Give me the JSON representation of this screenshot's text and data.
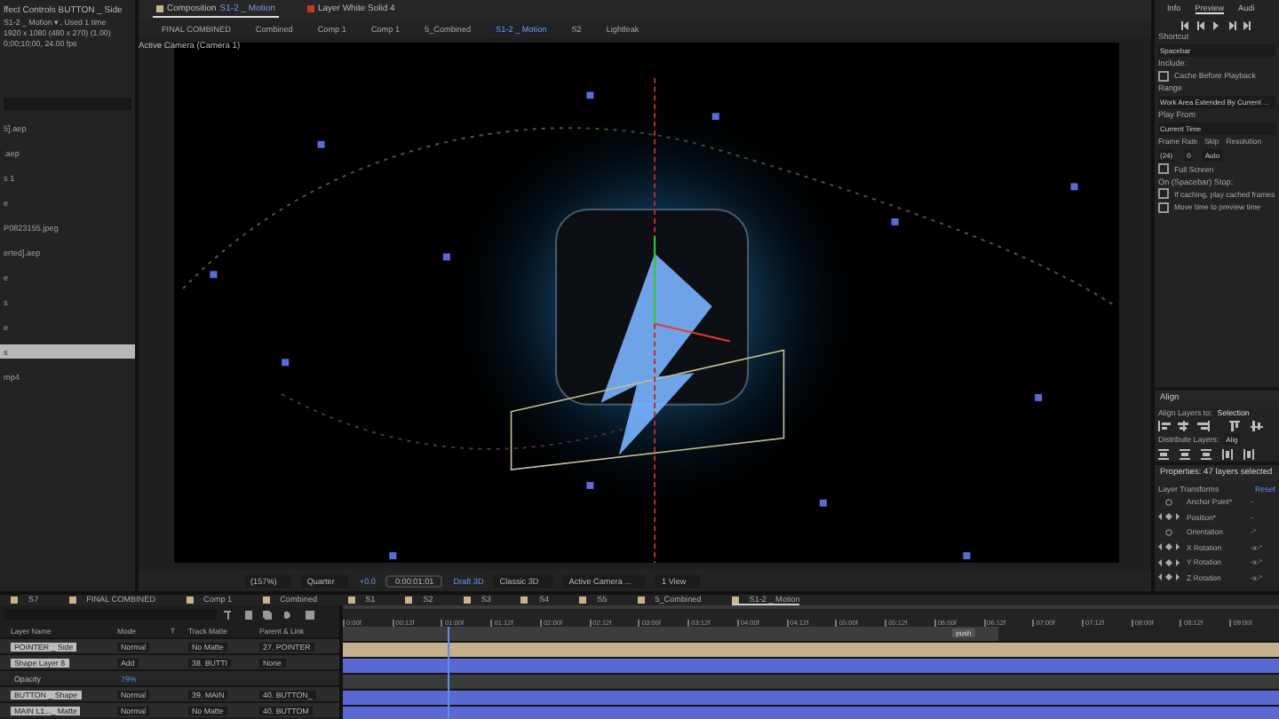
{
  "project_panel": {
    "title": "ffect Controls BUTTON _ Side",
    "info": [
      "S1-2 _ Motion ▾ , Used 1 time",
      "1920 x 1080 (480 x 270) (1.00)",
      "0;00;10;00, 24.00 fps"
    ],
    "items": [
      {
        "label": "5].aep",
        "selected": false
      },
      {
        "label": ".aep",
        "selected": false
      },
      {
        "label": "s 1",
        "selected": false
      },
      {
        "label": "e",
        "selected": false
      },
      {
        "label": "P0823155.jpeg",
        "selected": false
      },
      {
        "label": "erted].aep",
        "selected": false
      },
      {
        "label": "e",
        "selected": false
      },
      {
        "label": "s",
        "selected": false
      },
      {
        "label": "e",
        "selected": false
      },
      {
        "label": "s",
        "selected": true
      },
      {
        "label": "mp4",
        "selected": false
      }
    ]
  },
  "viewer": {
    "tabs": [
      {
        "label": "Composition",
        "name": "S1-2 _ Motion",
        "selected": true
      },
      {
        "label": "Layer White Solid 4",
        "selected": false
      }
    ],
    "breadcrumbs": [
      {
        "label": "FINAL COMBINED",
        "selected": false
      },
      {
        "label": "Combined",
        "selected": false
      },
      {
        "label": "Comp 1",
        "selected": false
      },
      {
        "label": "Comp 1",
        "selected": false
      },
      {
        "label": "5_Combined",
        "selected": false
      },
      {
        "label": "S1-2 _ Motion",
        "selected": true
      },
      {
        "label": "S2",
        "selected": false
      },
      {
        "label": "Lightleak",
        "selected": false
      }
    ],
    "camera_label": "Active Camera (Camera 1)",
    "footer": [
      {
        "kind": "dropdown",
        "label": "(157%)"
      },
      {
        "kind": "dropdown",
        "label": "Quarter"
      },
      {
        "kind": "text",
        "label": "+0.0"
      },
      {
        "kind": "field",
        "label": "0:00:01:01"
      },
      {
        "kind": "text",
        "label": "Draft 3D"
      },
      {
        "kind": "dropdown",
        "label": "Classic 3D"
      },
      {
        "kind": "dropdown",
        "label": "Active Camera ..."
      },
      {
        "kind": "dropdown",
        "label": "1 View"
      }
    ]
  },
  "right_panel": {
    "tabs": [
      {
        "label": "Info",
        "selected": false
      },
      {
        "label": "Preview",
        "selected": true
      },
      {
        "label": "Audi",
        "selected": false
      }
    ],
    "shortcut_label": "Shortcut",
    "shortcut": "Spacebar",
    "include_label": "Include:",
    "cache_before_playback": {
      "label": "Cache Before Playback",
      "checked": false
    },
    "range_label": "Range",
    "range": "Work Area Extended By Current ...",
    "play_from_label": "Play From",
    "play_from": "Current Time",
    "columns": [
      "Frame Rate",
      "Skip",
      "Resolution"
    ],
    "values": [
      "(24)",
      "0",
      "Auto"
    ],
    "full_screen": {
      "label": "Full Screen",
      "checked": false
    },
    "stop_label": "On (Spacebar) Stop:",
    "stop_options": [
      {
        "label": "If caching, play cached frames",
        "checked": false
      },
      {
        "label": "Move time to preview time",
        "checked": false
      }
    ],
    "align_title": "Align",
    "align_to_label": "Align Layers to:",
    "align_to": "Selection",
    "distribute_label": "Distribute Layers:",
    "distribute_button": "Alig",
    "properties_title": "Properties: 47 layers selected",
    "transforms_label": "Layer Transforms",
    "reset": "Reset",
    "properties": [
      {
        "kind": "plain",
        "label": "Anchor Point*",
        "value": "-"
      },
      {
        "kind": "keyframe",
        "label": "Position*",
        "value": "-"
      },
      {
        "kind": "plain",
        "label": "Orientation",
        "value": "-°"
      },
      {
        "kind": "keyframe",
        "label": "X Rotation",
        "value": "-x-°"
      },
      {
        "kind": "keyframe",
        "label": "Y Rotation",
        "value": "-x-°"
      },
      {
        "kind": "keyframe",
        "label": "Z Rotation",
        "value": "-x-°"
      }
    ]
  },
  "timeline": {
    "tabs": [
      {
        "label": "S7",
        "selected": false
      },
      {
        "label": "FINAL COMBINED",
        "selected": false
      },
      {
        "label": "Comp 1",
        "selected": false
      },
      {
        "label": "Combined",
        "selected": false
      },
      {
        "label": "S1",
        "selected": false
      },
      {
        "label": "S2",
        "selected": false
      },
      {
        "label": "S3",
        "selected": false
      },
      {
        "label": "S4",
        "selected": false
      },
      {
        "label": "S5",
        "selected": false
      },
      {
        "label": "5_Combined",
        "selected": false
      },
      {
        "label": "S1-2 _ Motion",
        "selected": true
      }
    ],
    "columns": [
      "Layer Name",
      "Mode",
      "T",
      "Track Matte",
      "Parent & Link"
    ],
    "ruler": [
      "0:00f",
      "00:12f",
      "01:00f",
      "01:12f",
      "02:00f",
      "02:12f",
      "03:00f",
      "03:12f",
      "04:00f",
      "04:12f",
      "05:00f",
      "05:12f",
      "06:00f",
      "06:12f",
      "07:00f",
      "07:12f",
      "08:00f",
      "08:12f",
      "09:00f"
    ],
    "marker": "push",
    "playhead": {
      "level": 0.112
    },
    "work_area": {
      "level": 0.7
    },
    "rows": [
      {
        "kind": "layer",
        "name": "POINTER _ Side",
        "mode": "Normal",
        "matte": "No Matte",
        "parent": "27. POINTER",
        "color": "#c4b08c"
      },
      {
        "kind": "layer",
        "name": "Shape Layer 8",
        "mode": "Add",
        "matte": "38. BUTTI",
        "parent": "None",
        "color": "#5a68d4"
      },
      {
        "kind": "property",
        "name": "Opacity",
        "value": "79%",
        "color": "#3a3a3a"
      },
      {
        "kind": "layer",
        "name": "BUTTON _ Shape",
        "mode": "Normal",
        "matte": "39. MAIN",
        "parent": "40. BUTTON_",
        "color": "#5a68d4"
      },
      {
        "kind": "layer",
        "name": "MAIN L1..._ Matte",
        "mode": "Normal",
        "matte": "No Matte",
        "parent": "40. BUTTOM",
        "color": "#5a68d4"
      }
    ]
  }
}
